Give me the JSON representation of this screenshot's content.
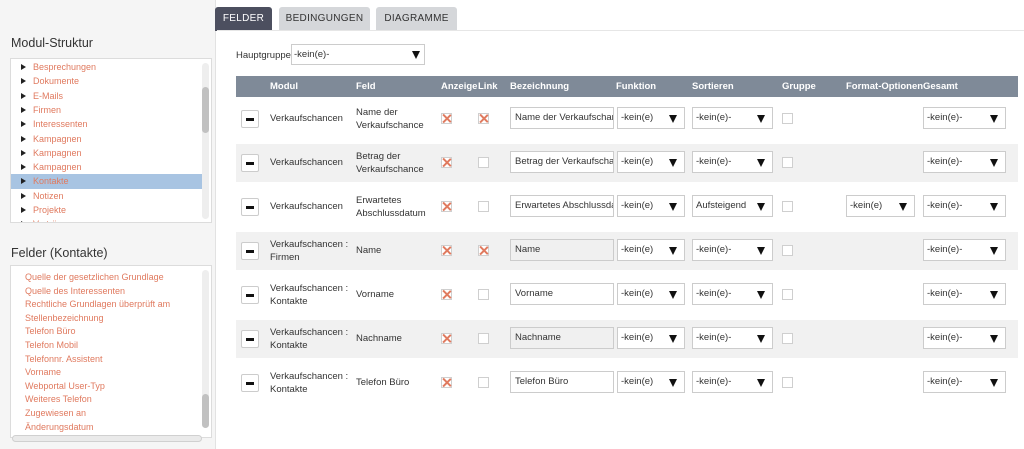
{
  "sidebar": {
    "module_title": "Modul-Struktur",
    "module_items": [
      {
        "label": "Besprechungen"
      },
      {
        "label": "Dokumente"
      },
      {
        "label": "E-Mails"
      },
      {
        "label": "Firmen"
      },
      {
        "label": "Interessenten"
      },
      {
        "label": "Kampagnen"
      },
      {
        "label": "Kampagnen"
      },
      {
        "label": "Kampagnen"
      },
      {
        "label": "Kontakte",
        "selected": true
      },
      {
        "label": "Notizen"
      },
      {
        "label": "Projekte"
      },
      {
        "label": "Verträge"
      }
    ],
    "fields_title": "Felder (Kontakte)",
    "field_items": [
      "Quelle der gesetzlichen Grundlage",
      "Quelle des Interessenten",
      "Rechtliche Grundlagen überprüft am",
      "Stellenbezeichnung",
      "Telefon Büro",
      "Telefon Mobil",
      "Telefonnr. Assistent",
      "Vorname",
      "Webportal User-Typ",
      "Weiteres Telefon",
      "Zugewiesen an",
      "Änderungsdatum"
    ]
  },
  "tabs": [
    {
      "label": "FELDER",
      "active": true
    },
    {
      "label": "BEDINGUNGEN",
      "active": false
    },
    {
      "label": "DIAGRAMME",
      "active": false
    }
  ],
  "hauptgruppe": {
    "label": "Hauptgruppe:",
    "value": "-kein(e)-"
  },
  "table": {
    "headers": {
      "modul": "Modul",
      "feld": "Feld",
      "anzeige": "Anzeige",
      "link": "Link",
      "bezeichnung": "Bezeichnung",
      "funktion": "Funktion",
      "sortieren": "Sortieren",
      "gruppe": "Gruppe",
      "format": "Format-Optionen",
      "gesamt": "Gesamt"
    },
    "rows": [
      {
        "modul": [
          "Verkaufschancen"
        ],
        "feld": [
          "Name der",
          "Verkaufschance"
        ],
        "anzeige": true,
        "link": true,
        "bezeichnung": "Name der Verkaufschance",
        "readonly": false,
        "funktion": "-kein(e)",
        "sortieren": "-kein(e)-",
        "format": null,
        "gesamt": "-kein(e)-"
      },
      {
        "modul": [
          "Verkaufschancen"
        ],
        "feld": [
          "Betrag der",
          "Verkaufschance"
        ],
        "anzeige": true,
        "link": false,
        "bezeichnung": "Betrag der Verkaufschance",
        "readonly": false,
        "funktion": "-kein(e)",
        "sortieren": "-kein(e)-",
        "format": null,
        "gesamt": "-kein(e)-"
      },
      {
        "modul": [
          "Verkaufschancen"
        ],
        "feld": [
          "Erwartetes",
          "Abschlussdatum"
        ],
        "anzeige": true,
        "link": false,
        "bezeichnung": "Erwartetes Abschlussdatum",
        "readonly": false,
        "funktion": "-kein(e)",
        "sortieren": "Aufsteigend",
        "format": "-kein(e)",
        "gesamt": "-kein(e)-"
      },
      {
        "modul": [
          "Verkaufschancen :",
          "Firmen"
        ],
        "feld": [
          "Name"
        ],
        "anzeige": true,
        "link": true,
        "bezeichnung": "Name",
        "readonly": true,
        "funktion": "-kein(e)",
        "sortieren": "-kein(e)-",
        "format": null,
        "gesamt": "-kein(e)-"
      },
      {
        "modul": [
          "Verkaufschancen :",
          "Kontakte"
        ],
        "feld": [
          "Vorname"
        ],
        "anzeige": true,
        "link": false,
        "bezeichnung": "Vorname",
        "readonly": false,
        "funktion": "-kein(e)",
        "sortieren": "-kein(e)-",
        "format": null,
        "gesamt": "-kein(e)-"
      },
      {
        "modul": [
          "Verkaufschancen :",
          "Kontakte"
        ],
        "feld": [
          "Nachname"
        ],
        "anzeige": true,
        "link": false,
        "bezeichnung": "Nachname",
        "readonly": true,
        "funktion": "-kein(e)",
        "sortieren": "-kein(e)-",
        "format": null,
        "gesamt": "-kein(e)-"
      },
      {
        "modul": [
          "Verkaufschancen :",
          "Kontakte"
        ],
        "feld": [
          "Telefon Büro"
        ],
        "anzeige": true,
        "link": false,
        "bezeichnung": "Telefon Büro",
        "readonly": false,
        "funktion": "-kein(e)",
        "sortieren": "-kein(e)-",
        "format": null,
        "gesamt": "-kein(e)-"
      }
    ]
  },
  "colors": {
    "accent": "#e07a5f",
    "tab_active": "#4c4f5f",
    "header_bg": "#7f8a98",
    "selected": "#a8c4e2"
  },
  "icons": {
    "tree": "triangle-right-icon",
    "remove": "minus-icon",
    "dropdown": "caret-down-icon",
    "checked": "x-mark-icon"
  }
}
